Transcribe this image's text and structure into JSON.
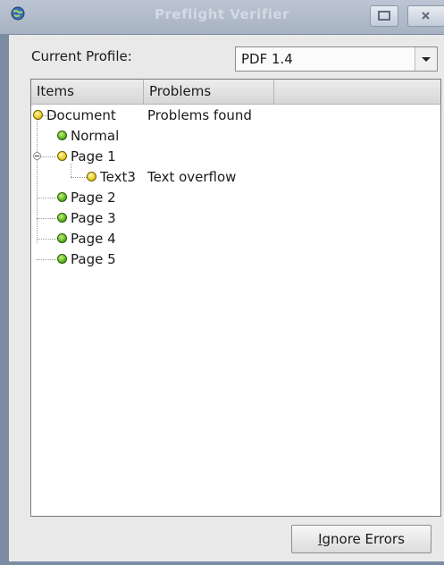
{
  "window": {
    "title": "Preflight Verifier"
  },
  "profile": {
    "label": "Current Profile:",
    "value": "PDF 1.4"
  },
  "tree": {
    "headers": {
      "items": "Items",
      "problems": "Problems"
    },
    "rows": [
      {
        "label": "Document",
        "problem": "Problems found",
        "status": "yellow"
      },
      {
        "label": "Normal",
        "problem": "",
        "status": "green"
      },
      {
        "label": "Page 1",
        "problem": "",
        "status": "yellow",
        "expanded": true
      },
      {
        "label": "Text3",
        "problem": "Text overflow",
        "status": "yellow"
      },
      {
        "label": "Page 2",
        "problem": "",
        "status": "green"
      },
      {
        "label": "Page 3",
        "problem": "",
        "status": "green"
      },
      {
        "label": "Page 4",
        "problem": "",
        "status": "green"
      },
      {
        "label": "Page 5",
        "problem": "",
        "status": "green"
      }
    ]
  },
  "buttons": {
    "ignore_mnemonic": "I",
    "ignore_rest": "gnore Errors"
  },
  "colors": {
    "status_yellow": "#e3c81a",
    "status_green": "#59b51e"
  },
  "icons": {
    "title": "globe-icon",
    "minimize": "minimize-icon",
    "close": "close-icon",
    "combo": "chevron-down-icon"
  }
}
